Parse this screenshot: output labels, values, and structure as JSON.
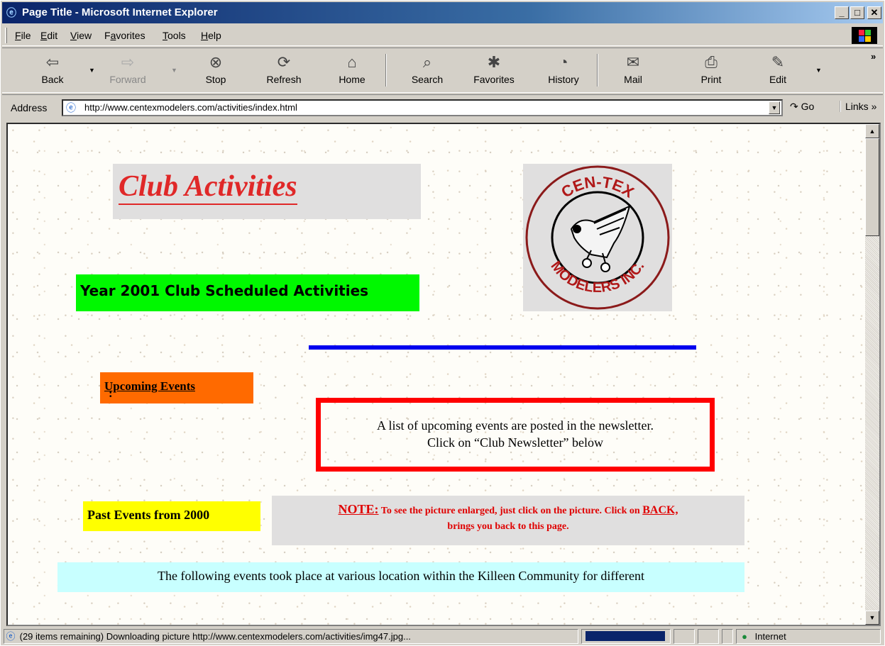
{
  "window": {
    "title": "Page Title - Microsoft Internet Explorer",
    "minimize_label": "_",
    "maximize_label": "□",
    "close_label": "✕"
  },
  "menubar": {
    "items": [
      {
        "label": "File",
        "accel": "F",
        "rest": "ile"
      },
      {
        "label": "Edit",
        "accel": "E",
        "rest": "dit"
      },
      {
        "label": "View",
        "accel": "V",
        "rest": "iew"
      },
      {
        "label": "Favorites",
        "pre": "F",
        "accel": "a",
        "rest": "vorites"
      },
      {
        "label": "Tools",
        "accel": "T",
        "rest": "ools"
      },
      {
        "label": "Help",
        "accel": "H",
        "rest": "elp"
      }
    ]
  },
  "toolbar": {
    "back": "Back",
    "forward": "Forward",
    "stop": "Stop",
    "refresh": "Refresh",
    "home": "Home",
    "search": "Search",
    "favorites": "Favorites",
    "history": "History",
    "mail": "Mail",
    "print": "Print",
    "edit": "Edit",
    "overflow": "»"
  },
  "address": {
    "label": "Address",
    "url": "http://www.centexmodelers.com/activities/index.html",
    "go_label": "Go",
    "links_label": "Links »"
  },
  "page": {
    "heading": "Club Activities",
    "logo_top_text": "CEN-TEX",
    "logo_bottom_text": "MODELERS INC.",
    "year_heading": "Year 2001 Club Scheduled Activities",
    "upcoming_label": "Upcoming Events",
    "upcoming_colon": ":",
    "notice_line1": "A list of upcoming events are posted in the newsletter.",
    "notice_line2": "Click on “Club Newsletter” below",
    "past_label": "Past Events from 2000",
    "note_label": "NOTE:",
    "note_text": " To see the picture enlarged, just click on the picture. Click  on ",
    "note_back": "BACK,",
    "note_text2": "brings you back to this page.",
    "following_text": "The following events took place at various location within the Killeen Community for different"
  },
  "statusbar": {
    "message": "(29 items remaining) Downloading picture http://www.centexmodelers.com/activities/img47.jpg...",
    "progress": 0.9,
    "zone": "Internet"
  },
  "colors": {
    "title_red": "#e02828",
    "year_green": "#00f800",
    "upcoming_orange": "#ff6a00",
    "notice_red": "#ff0000",
    "past_yellow": "#ffff00",
    "following_cyan": "#c8ffff",
    "rule_blue": "#0000ee"
  }
}
